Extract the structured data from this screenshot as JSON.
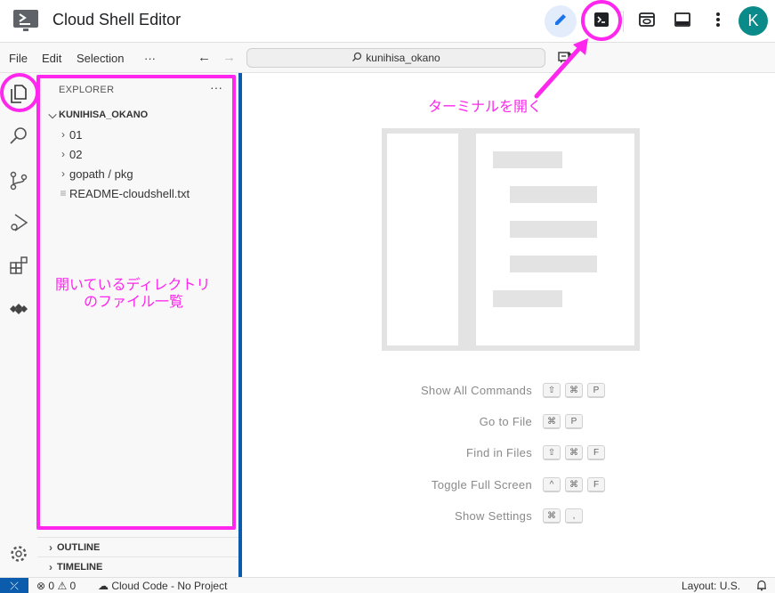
{
  "header": {
    "title": "Cloud Shell Editor",
    "avatar_initial": "K",
    "accent_color": "#1a73e8",
    "icons": [
      "cloud-shell-logo",
      "edit-icon",
      "terminal-icon",
      "preview-icon",
      "panel-icon",
      "more-vert-icon"
    ]
  },
  "menubar": {
    "items": [
      "File",
      "Edit",
      "Selection",
      "···"
    ],
    "search_text": "kunihisa_okano"
  },
  "activity_bar": {
    "icons": [
      "explorer-icon",
      "search-icon",
      "source-control-icon",
      "run-debug-icon",
      "extensions-icon",
      "cloud-code-icon",
      "settings-gear-icon"
    ]
  },
  "explorer": {
    "title": "EXPLORER",
    "more": "···",
    "root": "KUNIHISA_OKANO",
    "items": [
      {
        "label": "01",
        "type": "folder"
      },
      {
        "label": "02",
        "type": "folder"
      },
      {
        "label": "gopath / pkg",
        "type": "folder"
      },
      {
        "label": "README-cloudshell.txt",
        "type": "file"
      }
    ],
    "sections": [
      "OUTLINE",
      "TIMELINE"
    ]
  },
  "editor": {
    "shortcuts": [
      {
        "label": "Show All Commands",
        "keys": [
          "⇧",
          "⌘",
          "P"
        ]
      },
      {
        "label": "Go to File",
        "keys": [
          "⌘",
          "P"
        ]
      },
      {
        "label": "Find in Files",
        "keys": [
          "⇧",
          "⌘",
          "F"
        ]
      },
      {
        "label": "Toggle Full Screen",
        "keys": [
          "^",
          "⌘",
          "F"
        ]
      },
      {
        "label": "Show Settings",
        "keys": [
          "⌘",
          ","
        ]
      }
    ]
  },
  "statusbar": {
    "errors": "0",
    "warnings": "0",
    "cloud_code": "Cloud Code - No Project",
    "layout": "Layout: U.S."
  },
  "annotations": {
    "terminal_note": "ターミナルを開く",
    "explorer_note_line1": "開いているディレクトリ",
    "explorer_note_line2": "のファイル一覧",
    "color": "#ff26ee"
  }
}
